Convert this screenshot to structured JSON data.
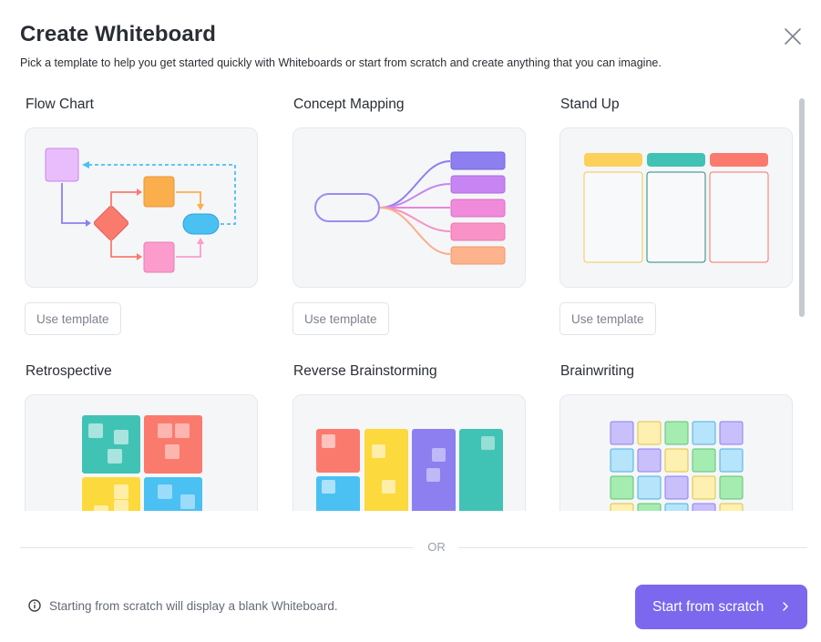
{
  "header": {
    "title": "Create Whiteboard",
    "subtitle": "Pick a template to help you get started quickly with Whiteboards or start from scratch and create anything that you can imagine.",
    "close_icon": "close-icon"
  },
  "templates": [
    {
      "title": "Flow Chart",
      "button": "Use template",
      "preview_icon": "flow-chart-preview"
    },
    {
      "title": "Concept Mapping",
      "button": "Use template",
      "preview_icon": "concept-map-preview"
    },
    {
      "title": "Stand Up",
      "button": "Use template",
      "preview_icon": "stand-up-preview"
    },
    {
      "title": "Retrospective",
      "preview_icon": "retrospective-preview"
    },
    {
      "title": "Reverse Brainstorming",
      "preview_icon": "reverse-brainstorming-preview"
    },
    {
      "title": "Brainwriting",
      "preview_icon": "brainwriting-preview"
    }
  ],
  "separator": {
    "label": "OR"
  },
  "footer": {
    "info_icon": "info-icon",
    "info_text": "Starting from scratch will display a blank Whiteboard.",
    "start_label": "Start from scratch",
    "start_icon": "chevron-right-icon"
  },
  "colors": {
    "accent": "#7b68ee",
    "preview_bg": "#f5f6f8",
    "purple": "#8d7ff0",
    "teal": "#40c3b5",
    "red": "#fb7a6e",
    "yellow": "#fcd43c",
    "blue": "#4bc0f3",
    "pink": "#fb9ccd",
    "orange": "#fba94e"
  }
}
